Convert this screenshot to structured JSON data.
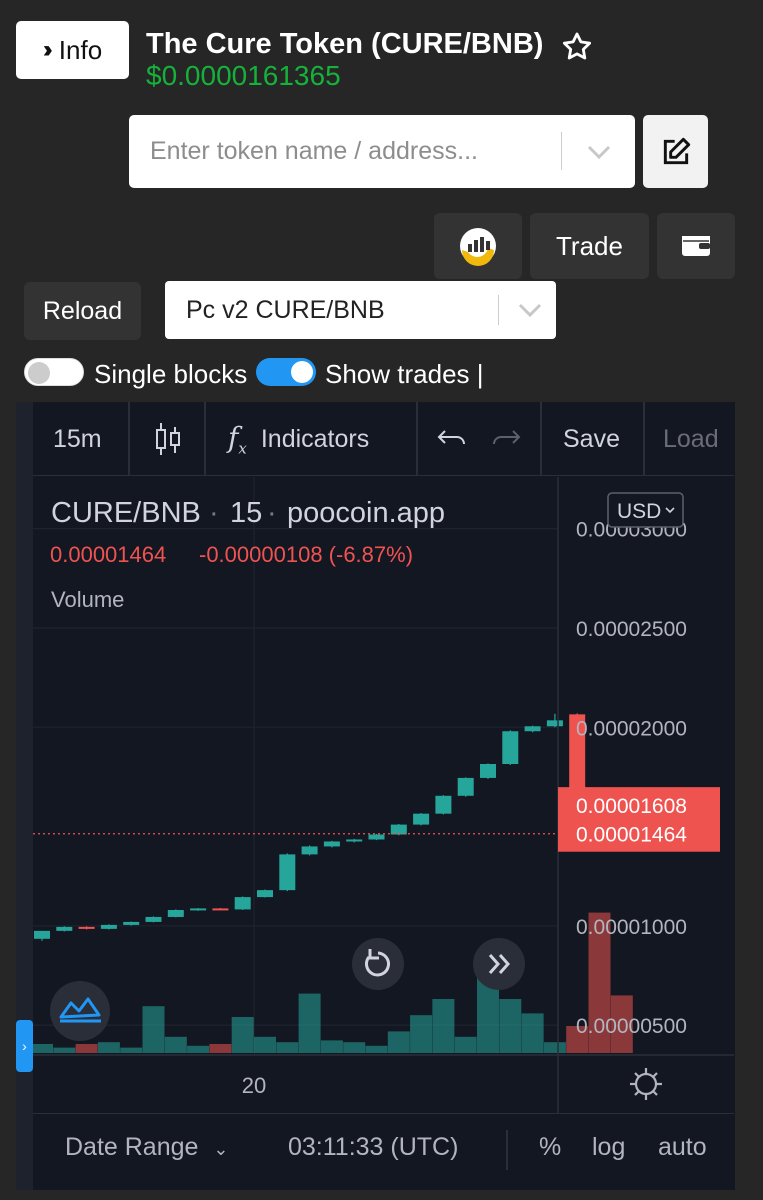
{
  "header": {
    "info_label": "Info",
    "title": "The Cure Token (CURE/BNB)",
    "price": "$0.0000161365"
  },
  "search": {
    "placeholder": "Enter token name / address..."
  },
  "toolbar": {
    "trade_label": "Trade",
    "reload_label": "Reload",
    "pair_selected": "Pc v2 CURE/BNB"
  },
  "toggles": {
    "single_blocks": {
      "label": "Single blocks",
      "on": false
    },
    "show_trades": {
      "label": "Show trades |",
      "on": true
    }
  },
  "chart_toolbar": {
    "interval": "15m",
    "indicators": "Indicators",
    "save": "Save",
    "load": "Load"
  },
  "chart_legend": {
    "symbol": "CURE/BNB",
    "interval": "15",
    "source": "poocoin.app",
    "last_price": "0.00001464",
    "change": "-0.00000108 (-6.87%)",
    "volume_label": "Volume",
    "currency": "USD"
  },
  "bottom_bar": {
    "date_range": "Date Range",
    "time": "03:11:33 (UTC)",
    "percent": "%",
    "log": "log",
    "auto": "auto"
  },
  "colors": {
    "up": "#26a69a",
    "down": "#ef5350",
    "price_green": "#16b13a",
    "accent": "#2196f3"
  },
  "chart_data": {
    "type": "candlestick",
    "x_tick_labels": [
      "20"
    ],
    "y_tick_labels": [
      "0.00003000",
      "0.00002500",
      "0.00002000",
      "0.00001000",
      "0.00000500"
    ],
    "ylim": [
      3.5e-06,
      3.26e-05
    ],
    "price_tags": [
      {
        "value": 1.608e-05,
        "label": "0.00001608"
      },
      {
        "value": 1.464e-05,
        "label": "0.00001464"
      }
    ],
    "candles": [
      {
        "o": 9.35e-06,
        "c": 9.75e-06,
        "h": 9.75e-06,
        "l": 9.25e-06
      },
      {
        "o": 9.75e-06,
        "c": 9.95e-06,
        "h": 9.98e-06,
        "l": 9.72e-06
      },
      {
        "o": 9.95e-06,
        "c": 9.85e-06,
        "h": 9.98e-06,
        "l": 9.82e-06
      },
      {
        "o": 9.85e-06,
        "c": 1.005e-05,
        "h": 1.008e-05,
        "l": 9.82e-06
      },
      {
        "o": 1.005e-05,
        "c": 1.02e-05,
        "h": 1.022e-05,
        "l": 1.002e-05
      },
      {
        "o": 1.02e-05,
        "c": 1.045e-05,
        "h": 1.048e-05,
        "l": 1.018e-05
      },
      {
        "o": 1.045e-05,
        "c": 1.08e-05,
        "h": 1.083e-05,
        "l": 1.043e-05
      },
      {
        "o": 1.08e-05,
        "c": 1.088e-05,
        "h": 1.09e-05,
        "l": 1.076e-05
      },
      {
        "o": 1.088e-05,
        "c": 1.083e-05,
        "h": 1.09e-05,
        "l": 1.08e-05
      },
      {
        "o": 1.083e-05,
        "c": 1.145e-05,
        "h": 1.148e-05,
        "l": 1.08e-05
      },
      {
        "o": 1.145e-05,
        "c": 1.18e-05,
        "h": 1.183e-05,
        "l": 1.143e-05
      },
      {
        "o": 1.18e-05,
        "c": 1.36e-05,
        "h": 1.365e-05,
        "l": 1.175e-05
      },
      {
        "o": 1.36e-05,
        "c": 1.4e-05,
        "h": 1.405e-05,
        "l": 1.355e-05
      },
      {
        "o": 1.4e-05,
        "c": 1.425e-05,
        "h": 1.428e-05,
        "l": 1.395e-05
      },
      {
        "o": 1.425e-05,
        "c": 1.435e-05,
        "h": 1.438e-05,
        "l": 1.42e-05
      },
      {
        "o": 1.435e-05,
        "c": 1.46e-05,
        "h": 1.463e-05,
        "l": 1.432e-05
      },
      {
        "o": 1.46e-05,
        "c": 1.51e-05,
        "h": 1.513e-05,
        "l": 1.456e-05
      },
      {
        "o": 1.51e-05,
        "c": 1.565e-05,
        "h": 1.568e-05,
        "l": 1.506e-05
      },
      {
        "o": 1.565e-05,
        "c": 1.655e-05,
        "h": 1.658e-05,
        "l": 1.561e-05
      },
      {
        "o": 1.655e-05,
        "c": 1.745e-05,
        "h": 1.748e-05,
        "l": 1.65e-05
      },
      {
        "o": 1.745e-05,
        "c": 1.815e-05,
        "h": 1.818e-05,
        "l": 1.74e-05
      },
      {
        "o": 1.815e-05,
        "c": 1.98e-05,
        "h": 1.985e-05,
        "l": 1.81e-05
      },
      {
        "o": 1.98e-05,
        "c": 2.005e-05,
        "h": 2.008e-05,
        "l": 1.975e-05
      },
      {
        "o": 2.005e-05,
        "c": 2.035e-05,
        "h": 2.068e-05,
        "l": 2e-05
      },
      {
        "o": 2.065e-05,
        "c": 1.655e-05,
        "h": 2.07e-05,
        "l": 1.65e-05
      },
      {
        "o": 1.62e-05,
        "c": 1.565e-05,
        "h": 1.63e-05,
        "l": 1.56e-05
      }
    ],
    "volume": [
      0.05,
      0.03,
      0.05,
      0.06,
      0.03,
      0.26,
      0.09,
      0.04,
      0.05,
      0.2,
      0.09,
      0.06,
      0.33,
      0.07,
      0.06,
      0.04,
      0.12,
      0.21,
      0.3,
      0.09,
      0.49,
      0.3,
      0.22,
      0.06,
      0.15,
      0.78,
      0.32
    ]
  }
}
